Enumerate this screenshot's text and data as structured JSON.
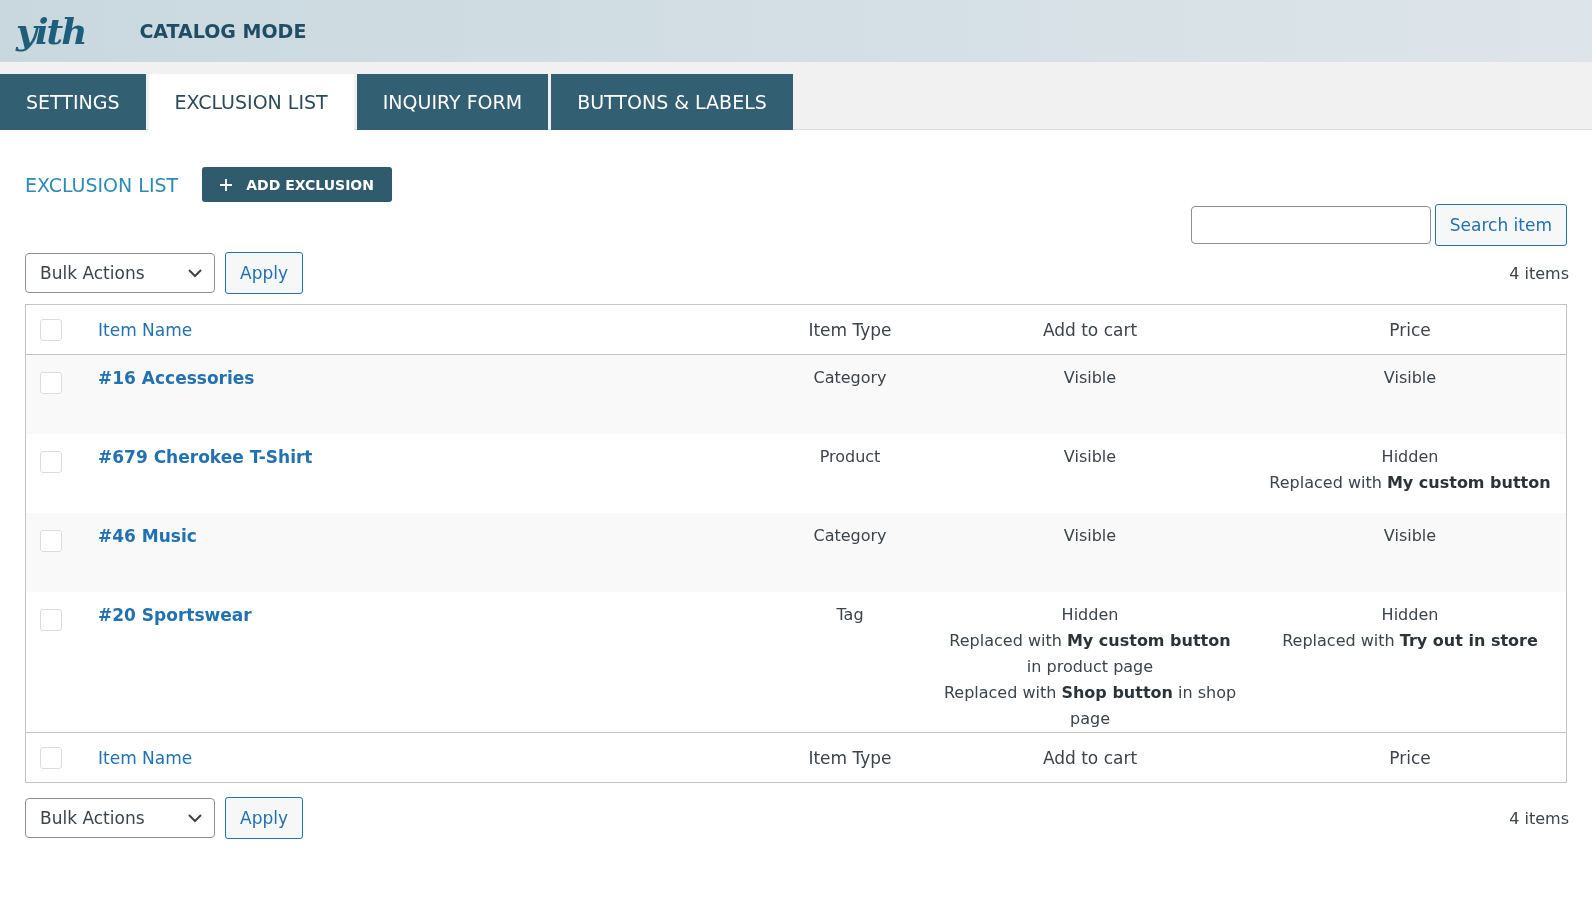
{
  "header": {
    "logo": "yith",
    "title": "CATALOG MODE"
  },
  "tabs": [
    {
      "label": "SETTINGS",
      "selected": false
    },
    {
      "label": "EXCLUSION LIST",
      "selected": true
    },
    {
      "label": "INQUIRY FORM",
      "selected": false
    },
    {
      "label": "BUTTONS & LABELS",
      "selected": false
    }
  ],
  "page": {
    "heading": "EXCLUSION LIST",
    "add_button": "ADD EXCLUSION"
  },
  "search": {
    "button": "Search item"
  },
  "top_nav": {
    "bulk_actions": "Bulk Actions",
    "apply": "Apply",
    "count": "4 items"
  },
  "table": {
    "select_all_checked": false,
    "footer_select_all_checked": false,
    "columns": [
      {
        "label": "Item Name",
        "kind": "link"
      },
      {
        "label": "Item Type",
        "kind": "plain"
      },
      {
        "label": "Add to cart",
        "kind": "plain"
      },
      {
        "label": "Price",
        "kind": "plain"
      }
    ],
    "rows": [
      {
        "checked": false,
        "name": "#16 Accessories",
        "type": "Category",
        "add_to_cart": [
          "Visible"
        ],
        "price": [
          "Visible"
        ]
      },
      {
        "checked": false,
        "name": "#679 Cherokee T-Shirt",
        "type": "Product",
        "add_to_cart": [
          "Visible"
        ],
        "price": [
          "Hidden",
          "Replaced with **My custom button**"
        ]
      },
      {
        "checked": false,
        "name": "#46 Music",
        "type": "Category",
        "add_to_cart": [
          "Visible"
        ],
        "price": [
          "Visible"
        ]
      },
      {
        "checked": false,
        "name": "#20 Sportswear",
        "type": "Tag",
        "add_to_cart": [
          "Hidden",
          "Replaced with **My custom button** in product page",
          "Replaced with **Shop button** in shop page"
        ],
        "price": [
          "Hidden",
          "Replaced with **Try out in store**"
        ]
      }
    ],
    "footer_columns": [
      {
        "label": "Item Name",
        "kind": "link"
      },
      {
        "label": "Item Type",
        "kind": "plain"
      },
      {
        "label": "Add to cart",
        "kind": "plain"
      },
      {
        "label": "Price",
        "kind": "plain"
      }
    ]
  },
  "bottom_nav": {
    "bulk_actions": "Bulk Actions",
    "apply": "Apply",
    "count": "4 items"
  }
}
